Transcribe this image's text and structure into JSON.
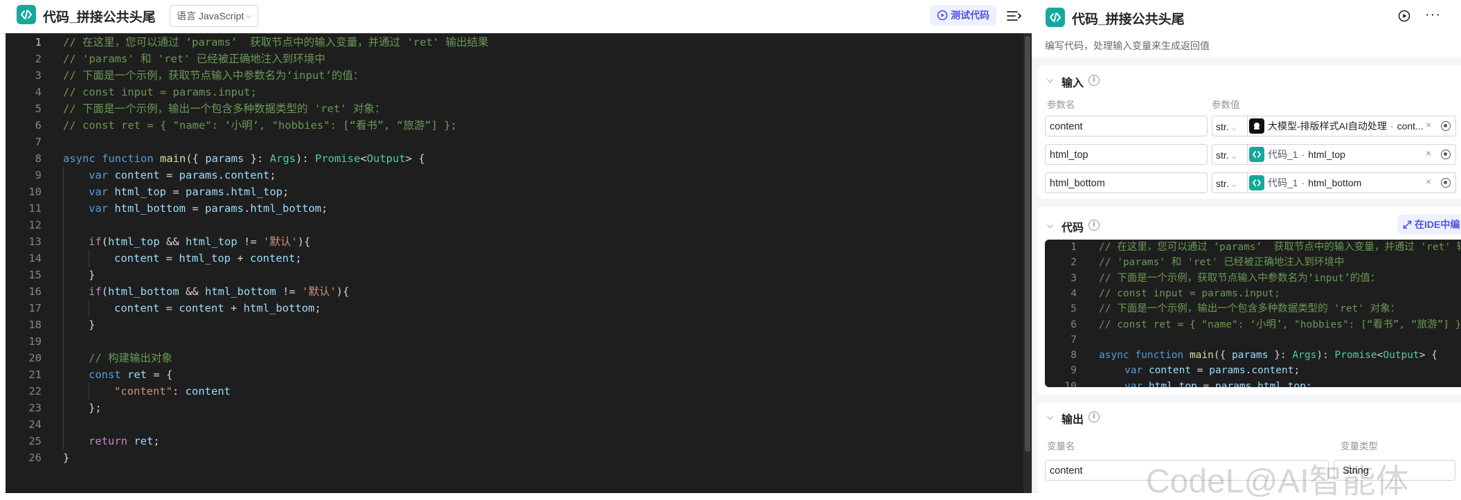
{
  "editor": {
    "title": "代码_拼接公共头尾",
    "language_label": "语言 JavaScript",
    "test_button_label": "测试代码",
    "line_numbers": [
      "1",
      "2",
      "3",
      "4",
      "5",
      "6",
      "7",
      "8",
      "9",
      "10",
      "11",
      "12",
      "13",
      "14",
      "15",
      "16",
      "17",
      "18",
      "19",
      "20",
      "21",
      "22",
      "23",
      "24",
      "25",
      "26"
    ]
  },
  "panel": {
    "title": "代码_拼接公共头尾",
    "description": "编写代码，处理输入变量来生成返回值",
    "input_section_title": "输入",
    "param_name_header": "参数名",
    "param_value_header": "参数值",
    "inputs": [
      {
        "name": "content",
        "type": "str.",
        "ref_node": "大模型-排版样式AI自动处理",
        "ref_var": "cont..."
      },
      {
        "name": "html_top",
        "type": "str.",
        "ref_node": "代码_1",
        "ref_var": "html_top"
      },
      {
        "name": "html_bottom",
        "type": "str.",
        "ref_node": "代码_1",
        "ref_var": "html_bottom"
      }
    ],
    "code_section_title": "代码",
    "ide_button_label": "在IDE中编",
    "mini_line_numbers": [
      "1",
      "2",
      "3",
      "4",
      "5",
      "6",
      "7",
      "8",
      "9",
      "10"
    ],
    "output_section_title": "输出",
    "var_name_header": "变量名",
    "var_type_header": "变量类型",
    "outputs": [
      {
        "name": "content",
        "type": "String"
      }
    ]
  },
  "watermark": "CodeL@AI智能体",
  "icons": {
    "node_code": "code-brackets-icon",
    "language_dropdown": "chevron-down-icon",
    "test": "play-circle-icon",
    "collapse_panel": "collapse-panel-icon",
    "run": "play-circle-icon",
    "more": "more-dots-icon",
    "ref_llm": "llm-node-icon",
    "ref_code": "code-brackets-icon",
    "clear": "close-icon",
    "reference": "target-icon",
    "expand": "expand-icon",
    "info": "info-icon"
  },
  "colors": {
    "accent": "#4d53e8",
    "code_node": "#16a89b",
    "editor_bg": "#1e1e1e"
  }
}
